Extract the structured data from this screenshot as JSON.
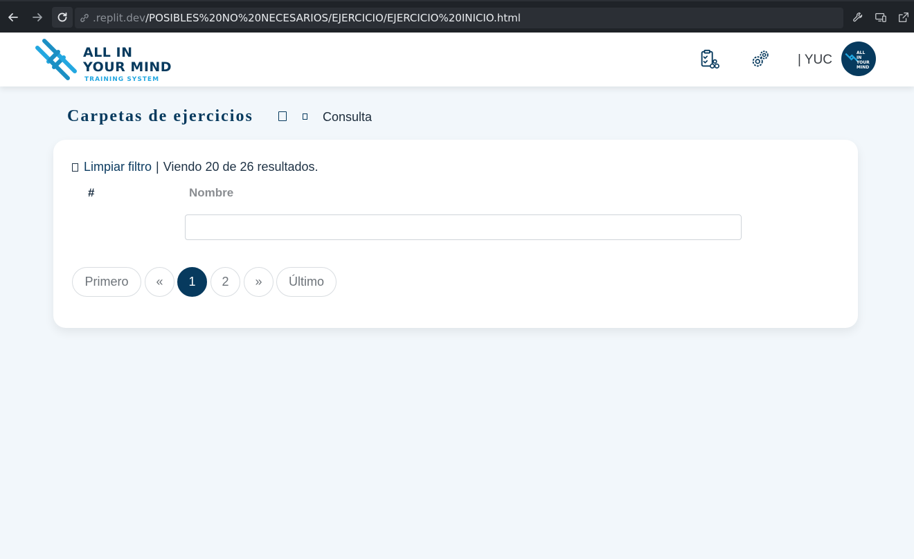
{
  "browser": {
    "url_host": ".replit.dev",
    "url_path": "/POSIBLES%20NO%20NECESARIOS/EJERCICIO/EJERCICIO%20INICIO.html"
  },
  "header": {
    "logo_line1": "ALL IN",
    "logo_line2": "YOUR MIND",
    "logo_line3": "TRAINING SYSTEM",
    "user_label": "| YUC",
    "avatar_text_1": "ALL",
    "avatar_text_2": "IN YOUR",
    "avatar_text_3": "MIND"
  },
  "breadcrumb": {
    "title": "Carpetas de ejercicios",
    "current": "Consulta"
  },
  "results": {
    "clear_filter": "Limpiar filtro",
    "separator": "|",
    "summary": "Viendo 20 de 26 resultados."
  },
  "table": {
    "columns": [
      "#",
      "Nombre"
    ],
    "name_filter_value": ""
  },
  "pagination": {
    "first": "Primero",
    "prev": "«",
    "pages": [
      "1",
      "2"
    ],
    "active_page": "1",
    "next": "»",
    "last": "Último"
  },
  "colors": {
    "brand_dark": "#073a5e",
    "brand_light": "#23a7e0",
    "background": "#f2f7fb"
  }
}
